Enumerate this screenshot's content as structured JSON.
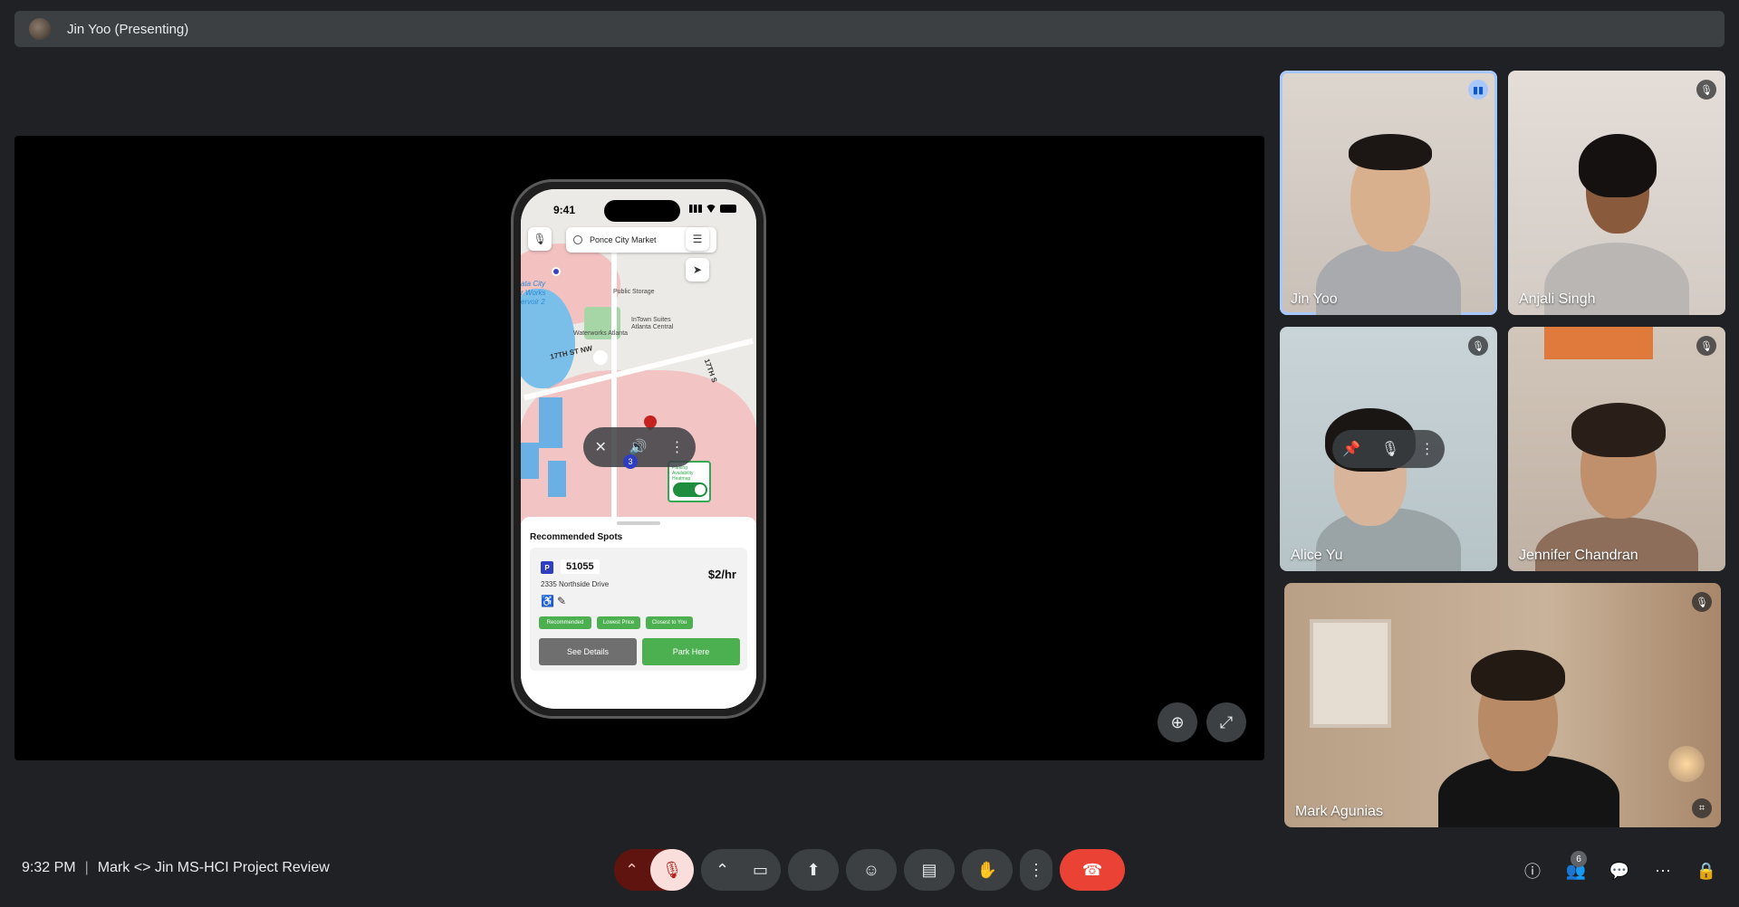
{
  "presenter": {
    "name": "Jin Yoo (Presenting)"
  },
  "phone": {
    "status_time": "9:41",
    "search_value": "Ponce City Market",
    "map_labels": {
      "public_storage": "Public Storage",
      "intown": "InTown Suites",
      "intown2": "Atlanta Central",
      "waterworks": "Waterworks Atlanta",
      "street_17th": "17TH ST NW",
      "street_17th_b": "17TH S",
      "water": "ata City\nr Works\nervoir 2"
    },
    "heatmap_label": "Parking Availability Heatmap",
    "cluster_count": "3",
    "sheet_title": "Recommended Spots",
    "spot": {
      "badge": "P",
      "id": "51055",
      "address": "2335 Northside Drive",
      "price": "$2/hr",
      "tags": [
        "Recommended",
        "Lowest Price",
        "Closest to You"
      ],
      "details_label": "See Details",
      "park_label": "Park Here"
    }
  },
  "participants": [
    {
      "name": "Jin Yoo",
      "status": "speaking"
    },
    {
      "name": "Anjali Singh",
      "status": "muted"
    },
    {
      "name": "Alice Yu",
      "status": "muted"
    },
    {
      "name": "Jennifer Chandran",
      "status": "muted"
    },
    {
      "name": "Mark Agunias",
      "status": "muted"
    }
  ],
  "bottom": {
    "time": "9:32 PM",
    "separator": "|",
    "meeting_title": "Mark <> Jin MS-HCI Project Review",
    "people_count": "6"
  },
  "colors": {
    "background": "#202124",
    "hangup": "#ea4335",
    "active_outline": "#a8c7fa",
    "park_green": "#4caf50"
  }
}
